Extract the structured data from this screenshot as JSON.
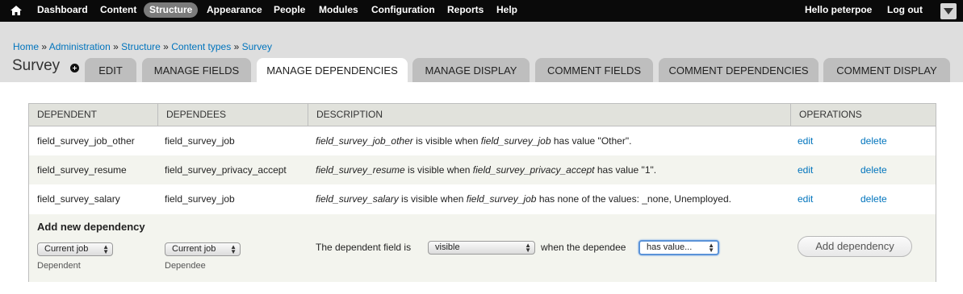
{
  "toolbar": {
    "home_icon": "home-icon",
    "menu": [
      "Dashboard",
      "Content",
      "Structure",
      "Appearance",
      "People",
      "Modules",
      "Configuration",
      "Reports",
      "Help"
    ],
    "active": "Structure",
    "greeting_prefix": "Hello ",
    "username": "peterpoe",
    "logout": "Log out",
    "toggle_icon": "chevron-down-icon"
  },
  "breadcrumb": {
    "items": [
      "Home",
      "Administration",
      "Structure",
      "Content types",
      "Survey"
    ],
    "separator": "»"
  },
  "page": {
    "title": "Survey",
    "shortcut_icon": "add-shortcut-icon"
  },
  "tabs": [
    "Edit",
    "Manage fields",
    "Manage dependencies",
    "Manage display",
    "Comment fields",
    "Comment dependencies",
    "Comment display"
  ],
  "active_tab": "Manage dependencies",
  "table": {
    "headers": [
      "Dependent",
      "Dependees",
      "Description",
      "Operations"
    ],
    "rows": [
      {
        "dependent": "field_survey_job_other",
        "dependee": "field_survey_job",
        "desc_field": "field_survey_job_other",
        "desc_mid": " is visible when ",
        "desc_dependee": "field_survey_job",
        "desc_tail": " has value \"Other\".",
        "edit": "edit",
        "delete": "delete"
      },
      {
        "dependent": "field_survey_resume",
        "dependee": "field_survey_privacy_accept",
        "desc_field": "field_survey_resume",
        "desc_mid": " is visible when ",
        "desc_dependee": "field_survey_privacy_accept",
        "desc_tail": " has value \"1\".",
        "edit": "edit",
        "delete": "delete"
      },
      {
        "dependent": "field_survey_salary",
        "dependee": "field_survey_job",
        "desc_field": "field_survey_salary",
        "desc_mid": " is visible when ",
        "desc_dependee": "field_survey_job",
        "desc_tail": " has none of the values: _none, Unemployed.",
        "edit": "edit",
        "delete": "delete"
      }
    ]
  },
  "add_new": {
    "title": "Add new dependency",
    "dependent_select": "Current job",
    "dependent_label": "Dependent",
    "dependee_select": "Current job",
    "dependee_label": "Dependee",
    "state_prefix": "The dependent field is",
    "state_select": "visible",
    "condition_prefix": "when the dependee",
    "condition_select": "has value...",
    "button": "Add dependency"
  },
  "colors": {
    "toolbar_bg": "#0a0a0a",
    "header_bg": "#dedede",
    "link": "#0074bd",
    "tab_bg": "#bebebe",
    "active_tab_bg": "#ffffff"
  }
}
